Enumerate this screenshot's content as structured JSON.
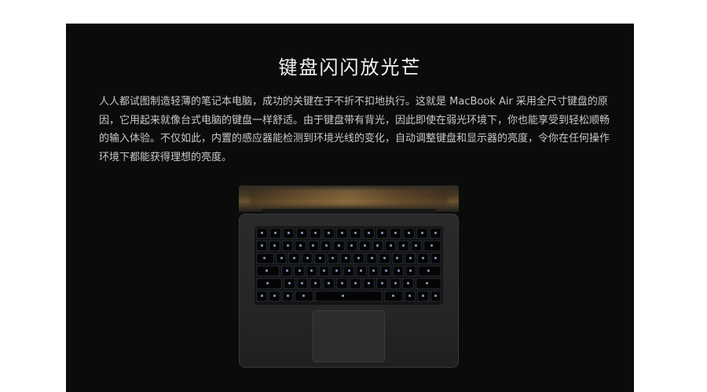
{
  "section": {
    "title": "键盘闪闪放光芒",
    "description": "人人都试图制造轻薄的笔记本电脑，成功的关键在于不折不扣地执行。这就是 MacBook Air 采用全尺寸键盘的原因，它用起来就像台式电脑的键盘一样舒适。由于键盘带有背光，因此即使在弱光环境下，你也能享受到轻松顺畅的输入体验。不仅如此，内置的感应器能检测到环境光线的变化，自动调整键盘和显示器的亮度，令你在任何操作环境下都能获得理想的亮度。"
  },
  "colors": {
    "panel_background": "#0b0b0b",
    "title_text": "#f2f2f2",
    "body_text": "#c9c9c9",
    "key_backlight": "#9fb4e6"
  },
  "image": {
    "subject": "macbook-air-backlit-keyboard"
  }
}
